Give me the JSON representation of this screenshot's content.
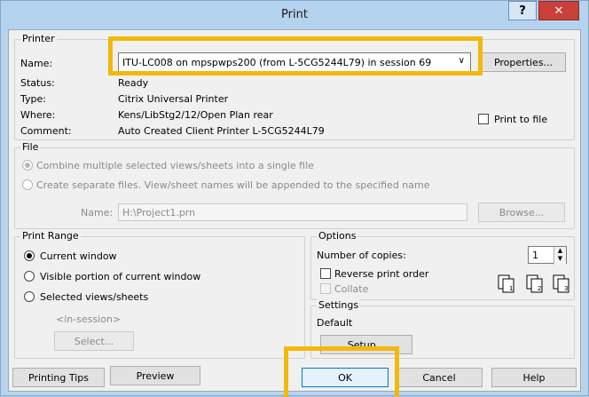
{
  "window": {
    "title": "Print",
    "help": "?",
    "close": "✕"
  },
  "printer": {
    "group_title": "Printer",
    "name_label": "Name:",
    "name_value": "ITU-LC008 on mpspwps200 (from L-5CG5244L79) in session 69",
    "properties": "Properties...",
    "status_label": "Status:",
    "status_value": "Ready",
    "type_label": "Type:",
    "type_value": "Citrix Universal Printer",
    "where_label": "Where:",
    "where_value": "Kens/LibStg2/12/Open Plan rear",
    "comment_label": "Comment:",
    "comment_value": "Auto Created Client Printer L-5CG5244L79",
    "print_to_file": "Print to file"
  },
  "file": {
    "group_title": "File",
    "combine": "Combine multiple selected views/sheets into a single file",
    "separate": "Create separate files. View/sheet names will be appended to the specified name",
    "name_label": "Name:",
    "name_value": "H:\\Project1.prn",
    "browse": "Browse..."
  },
  "print_range": {
    "group_title": "Print Range",
    "current": "Current window",
    "visible": "Visible portion of current window",
    "selected": "Selected views/sheets",
    "in_session": "<in-session>",
    "select": "Select..."
  },
  "options": {
    "group_title": "Options",
    "copies_label": "Number of copies:",
    "copies_value": "1",
    "reverse": "Reverse print order",
    "collate": "Collate"
  },
  "settings": {
    "group_title": "Settings",
    "value": "Default",
    "setup": "Setup..."
  },
  "footer": {
    "tips": "Printing Tips",
    "preview": "Preview",
    "ok": "OK",
    "cancel": "Cancel",
    "help": "Help"
  },
  "colors": {
    "highlight": "#f2b90c"
  }
}
